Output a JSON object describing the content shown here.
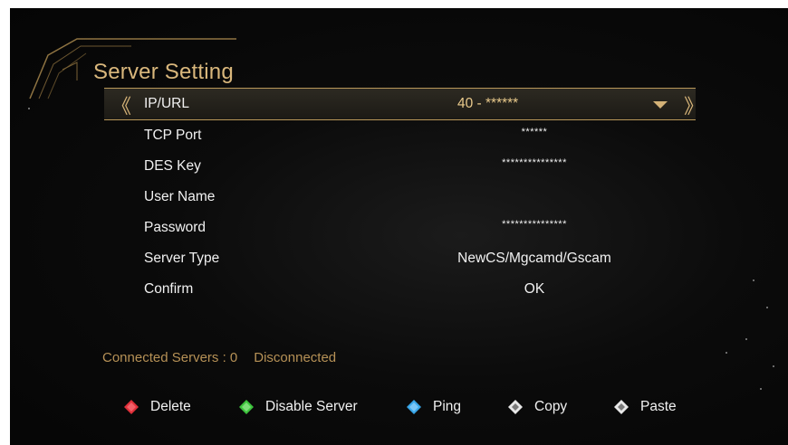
{
  "title": "Server Setting",
  "fields": [
    {
      "label": "IP/URL",
      "value": "40 - ******",
      "selected": true
    },
    {
      "label": "TCP Port",
      "value": "******"
    },
    {
      "label": "DES Key",
      "value": "***************"
    },
    {
      "label": "User Name",
      "value": ""
    },
    {
      "label": "Password",
      "value": "***************"
    },
    {
      "label": "Server Type",
      "value": "NewCS/Mgcamd/Gscam"
    },
    {
      "label": "Confirm",
      "value": "OK"
    }
  ],
  "status": {
    "connected_label": "Connected Servers : 0",
    "state": "Disconnected"
  },
  "hints": [
    {
      "label": "Delete",
      "icon": "red-diamond-icon",
      "color": "#e0303a"
    },
    {
      "label": "Disable Server",
      "icon": "green-diamond-icon",
      "color": "#3cc23c"
    },
    {
      "label": "Ping",
      "icon": "blue-diamond-icon",
      "color": "#38a6e8"
    },
    {
      "label": "Copy",
      "icon": "white-diamond-icon",
      "color": "#e8e8e8"
    },
    {
      "label": "Paste",
      "icon": "white-diamond-icon",
      "color": "#e8e8e8"
    }
  ],
  "colors": {
    "accent": "#d9b77c",
    "status": "#b69156",
    "text": "#f1f1f1"
  }
}
